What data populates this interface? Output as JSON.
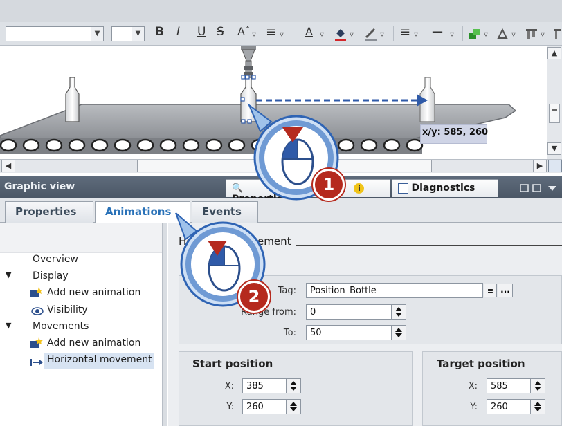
{
  "toolbar": {
    "bold": "B",
    "italic": "I",
    "underline": "U",
    "strike": "S",
    "font_size_up": "Aˆ",
    "align": "≡",
    "text_color": "A",
    "fill": "▰",
    "line": "╱",
    "list": "≡",
    "line_style": "—",
    "dropdown_glyph": "▿"
  },
  "scene": {
    "coordinate_label": "x/y: 585, 260"
  },
  "panel": {
    "title": "Graphic view",
    "tabs": [
      {
        "label": "Properties"
      },
      {
        "label": "Info"
      },
      {
        "label": "Diagnostics"
      }
    ]
  },
  "subtabs": [
    "Properties",
    "Animations",
    "Events"
  ],
  "tree": {
    "overview": "Overview",
    "display": "Display",
    "display_add": "Add new animation",
    "visibility": "Visibility",
    "movements": "Movements",
    "movements_add": "Add new animation",
    "horizontal": "Horizontal movement"
  },
  "form": {
    "section_title": "Horizontal movement",
    "tag_label": "Tag:",
    "tag_value": "Position_Bottle",
    "range_from_label": "Range from:",
    "range_from_value": "0",
    "to_label": "To:",
    "to_value": "50",
    "start_title": "Start position",
    "start_x_label": "X:",
    "start_x": "385",
    "start_y_label": "Y:",
    "start_y": "260",
    "target_title": "Target position",
    "target_x_label": "X:",
    "target_x": "585",
    "target_y_label": "Y:",
    "target_y": "260"
  },
  "callouts": {
    "step1": "1",
    "step2": "2"
  },
  "colors": {
    "arrow": "#2f5aa8",
    "callout_ring": "#3c74c8",
    "badge": "#b52a1e",
    "pointer": "#c0302a"
  }
}
